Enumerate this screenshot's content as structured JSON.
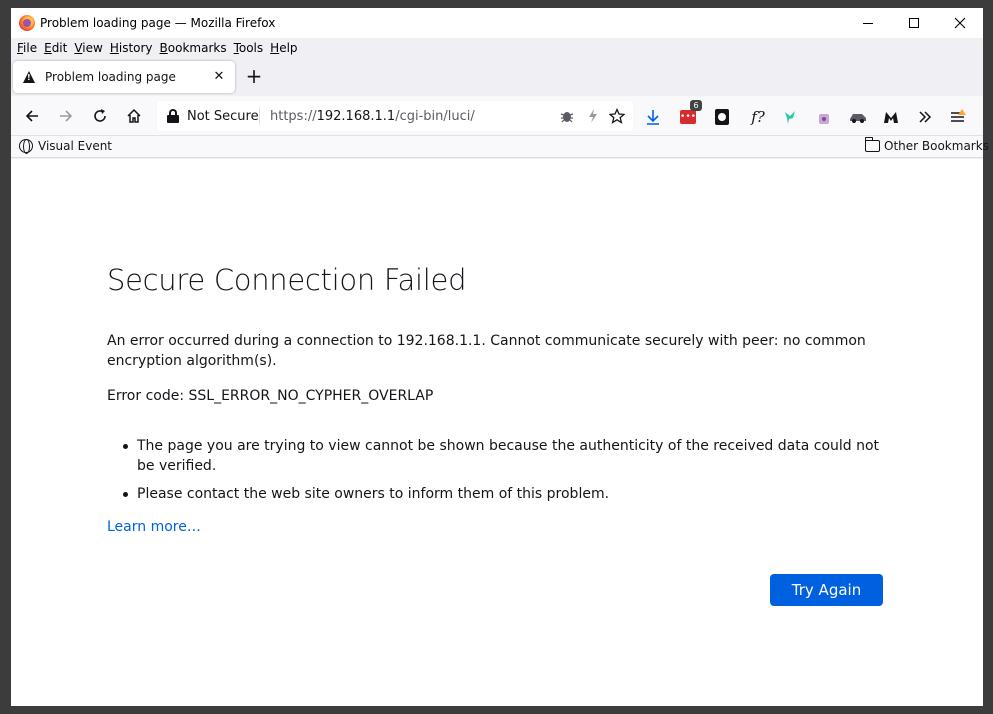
{
  "window": {
    "title": "Problem loading page — Mozilla Firefox"
  },
  "menubar": {
    "items": [
      {
        "label": "File",
        "accel": "F",
        "rest": "ile"
      },
      {
        "label": "Edit",
        "accel": "E",
        "rest": "dit"
      },
      {
        "label": "View",
        "accel": "V",
        "rest": "iew"
      },
      {
        "label": "History",
        "accel": "H",
        "rest": "istory"
      },
      {
        "label": "Bookmarks",
        "accel": "B",
        "rest": "ookmarks"
      },
      {
        "label": "Tools",
        "accel": "T",
        "rest": "ools"
      },
      {
        "label": "Help",
        "accel": "H",
        "rest": "elp"
      }
    ]
  },
  "tabs": [
    {
      "label": "Problem loading page",
      "close": "✕"
    }
  ],
  "newtab": "+",
  "urlbar": {
    "security_label": "Not Secure",
    "url_prefix": "https://",
    "url_host": "192.168.1.1",
    "url_path": "/cgi-bin/luci/"
  },
  "toolbar": {
    "extension_badge": "6",
    "fx_label": "f?"
  },
  "bookmarks": {
    "left_item": "Visual Event",
    "right_item": "Other Bookmarks"
  },
  "error_page": {
    "title": "Secure Connection Failed",
    "description": "An error occurred during a connection to 192.168.1.1. Cannot communicate securely with peer: no common encryption algorithm(s).",
    "error_code": "Error code: SSL_ERROR_NO_CYPHER_OVERLAP",
    "bullets": [
      "The page you are trying to view cannot be shown because the authenticity of the received data could not be verified.",
      "Please contact the web site owners to inform them of this problem."
    ],
    "learn_more": "Learn more…",
    "try_again": "Try Again"
  },
  "colors": {
    "accent": "#0061e0",
    "text": "#15141a",
    "chrome": "#f0f0f4"
  }
}
